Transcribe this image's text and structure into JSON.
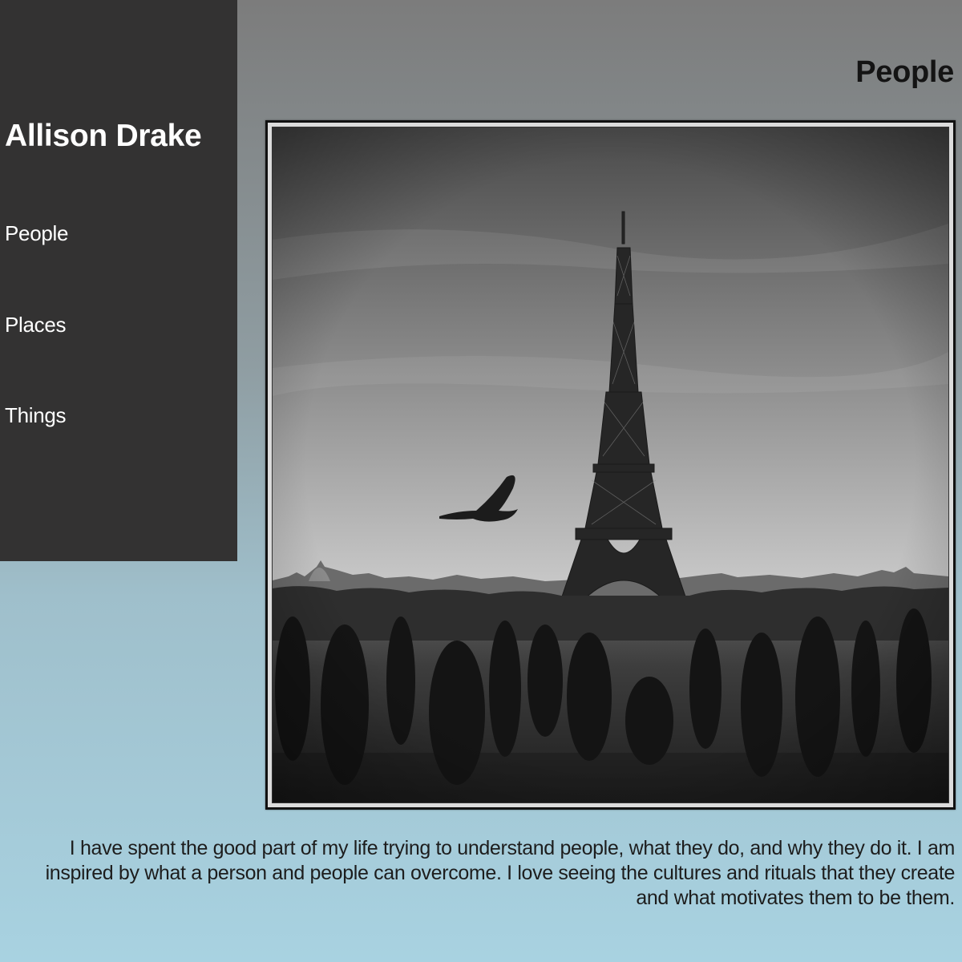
{
  "sidebar": {
    "site_name": "Allison Drake",
    "nav": [
      {
        "label": "People"
      },
      {
        "label": "Places"
      },
      {
        "label": "Things"
      }
    ]
  },
  "main": {
    "title": "People",
    "photo": {
      "subject": "Eiffel Tower with a bird in flight and silhouetted crowd, black and white"
    },
    "caption": "I have spent the good part of my life trying to understand people, what they do, and why they do it. I am inspired by what a person and people can overcome. I love seeing the cultures and rituals that they create and what motivates them to be them."
  },
  "colors": {
    "sidebar_bg": "#333232",
    "sidebar_text": "#ffffff",
    "bg_gradient_top": "#7c7c7c",
    "bg_gradient_bottom": "#a8d2e1",
    "body_text": "#1d1d1d"
  }
}
